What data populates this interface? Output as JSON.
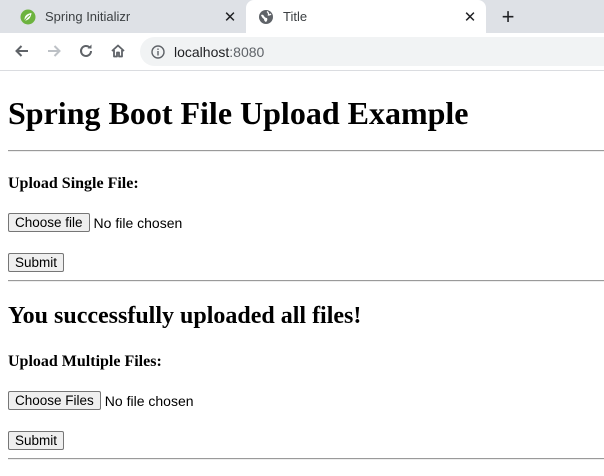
{
  "browser": {
    "tabs": [
      {
        "label": "Spring Initializr",
        "icon": "spring-logo-icon",
        "active": false
      },
      {
        "label": "Title",
        "icon": "globe-icon",
        "active": true
      }
    ],
    "new_tab_icon": "plus-icon",
    "nav": {
      "back": "back-arrow-icon",
      "forward": "forward-arrow-icon",
      "reload": "reload-icon",
      "home": "home-icon"
    },
    "url": {
      "host": "localhost",
      "port": ":8080"
    }
  },
  "page": {
    "title": "Spring Boot File Upload Example",
    "single": {
      "heading": "Upload Single File:",
      "choose_label": "Choose file",
      "status": "No file chosen",
      "submit_label": "Submit"
    },
    "message": "You successfully uploaded all files!",
    "multiple": {
      "heading": "Upload Multiple Files:",
      "choose_label": "Choose Files",
      "status": "No file chosen",
      "submit_label": "Submit"
    }
  },
  "colors": {
    "spring_green": "#6db33f",
    "tabbar": "#dee1e6",
    "omnibox": "#f1f3f4"
  }
}
